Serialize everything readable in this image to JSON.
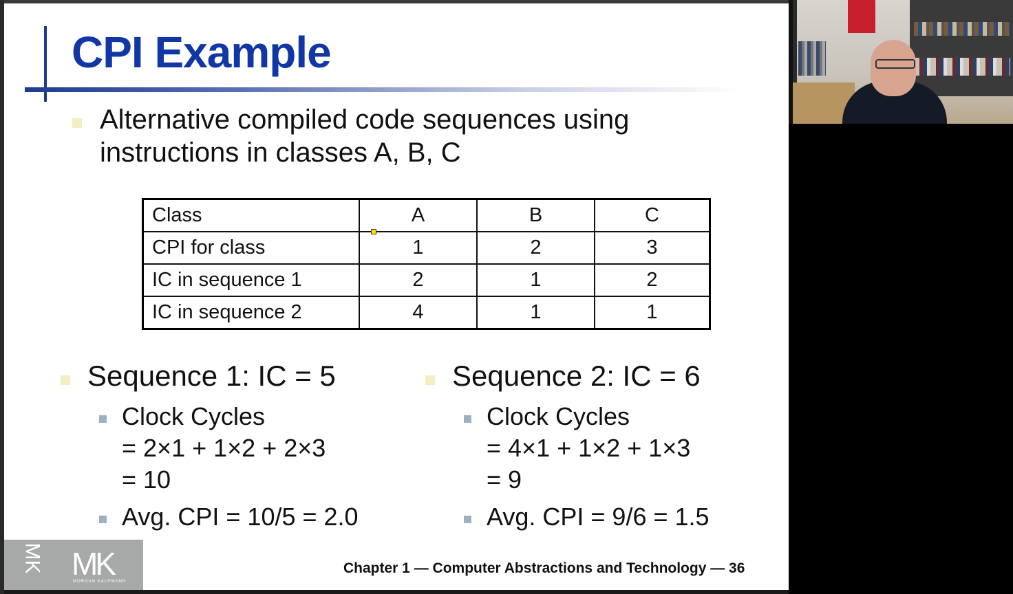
{
  "slide": {
    "title": "CPI Example",
    "intro_line1": "Alternative compiled code sequences using",
    "intro_line2": "instructions in classes A, B, C",
    "table": {
      "header": [
        "Class",
        "A",
        "B",
        "C"
      ],
      "rows": [
        [
          "CPI for class",
          "1",
          "2",
          "3"
        ],
        [
          "IC in sequence 1",
          "2",
          "1",
          "2"
        ],
        [
          "IC in sequence 2",
          "4",
          "1",
          "1"
        ]
      ]
    },
    "seq1": {
      "heading": "Sequence 1: IC = 5",
      "cycles_label": "Clock Cycles",
      "cycles_line1": "= 2×1 + 1×2 + 2×3",
      "cycles_line2": "= 10",
      "avg": "Avg. CPI = 10/5 = 2.0"
    },
    "seq2": {
      "heading": "Sequence 2: IC = 6",
      "cycles_label": "Clock Cycles",
      "cycles_line1": "= 4×1 + 1×2 + 1×3",
      "cycles_line2": "= 9",
      "avg": "Avg. CPI = 9/6 = 1.5"
    },
    "logo_text": "MK",
    "logo_subtext": "MORGAN KAUFMANN",
    "footer": "Chapter 1 — Computer Abstractions and Technology — 36"
  },
  "colors": {
    "title": "#1137a6",
    "accent_line": "#1b3a8f",
    "bullet": "#f2efc4",
    "sub_bullet": "#9eb1c2",
    "logo_bg": "#a7a9a9"
  }
}
